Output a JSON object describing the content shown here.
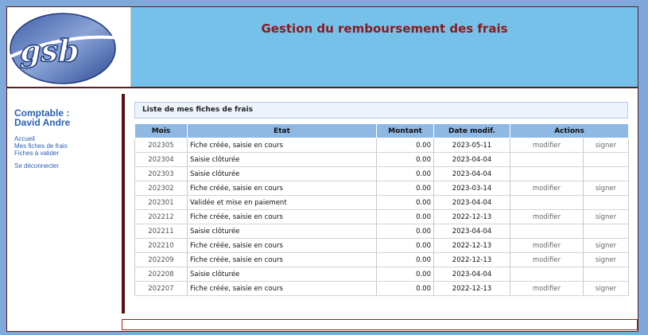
{
  "header": {
    "logo_text": "gsb",
    "title": "Gestion du remboursement des frais"
  },
  "sidebar": {
    "role": "Comptable :",
    "name": "David Andre",
    "menu": [
      "Accueil",
      "Mes fiches de frais",
      "Fiches à valider"
    ],
    "logout": "Se déconnecter"
  },
  "main": {
    "section_title": "Liste de mes fiches de frais",
    "columns": [
      "Mois",
      "Etat",
      "Montant",
      "Date modif.",
      "Actions"
    ],
    "rows": [
      {
        "mois": "202305",
        "etat": "Fiche créée, saisie en cours",
        "montant": "0.00",
        "date": "2023-05-11",
        "modifier": "modifier",
        "signer": "signer"
      },
      {
        "mois": "202304",
        "etat": "Saisie clôturée",
        "montant": "0.00",
        "date": "2023-04-04",
        "modifier": "",
        "signer": ""
      },
      {
        "mois": "202303",
        "etat": "Saisie clôturée",
        "montant": "0.00",
        "date": "2023-04-04",
        "modifier": "",
        "signer": ""
      },
      {
        "mois": "202302",
        "etat": "Fiche créée, saisie en cours",
        "montant": "0.00",
        "date": "2023-03-14",
        "modifier": "modifier",
        "signer": "signer"
      },
      {
        "mois": "202301",
        "etat": "Validée et mise en paiement",
        "montant": "0.00",
        "date": "2023-04-04",
        "modifier": "",
        "signer": ""
      },
      {
        "mois": "202212",
        "etat": "Fiche créée, saisie en cours",
        "montant": "0.00",
        "date": "2022-12-13",
        "modifier": "modifier",
        "signer": "signer"
      },
      {
        "mois": "202211",
        "etat": "Saisie clôturée",
        "montant": "0.00",
        "date": "2023-04-04",
        "modifier": "",
        "signer": ""
      },
      {
        "mois": "202210",
        "etat": "Fiche créée, saisie en cours",
        "montant": "0.00",
        "date": "2022-12-13",
        "modifier": "modifier",
        "signer": "signer"
      },
      {
        "mois": "202209",
        "etat": "Fiche créée, saisie en cours",
        "montant": "0.00",
        "date": "2022-12-13",
        "modifier": "modifier",
        "signer": "signer"
      },
      {
        "mois": "202208",
        "etat": "Saisie clôturée",
        "montant": "0.00",
        "date": "2023-04-04",
        "modifier": "",
        "signer": ""
      },
      {
        "mois": "202207",
        "etat": "Fiche créée, saisie en cours",
        "montant": "0.00",
        "date": "2022-12-13",
        "modifier": "modifier",
        "signer": "signer"
      }
    ]
  }
}
